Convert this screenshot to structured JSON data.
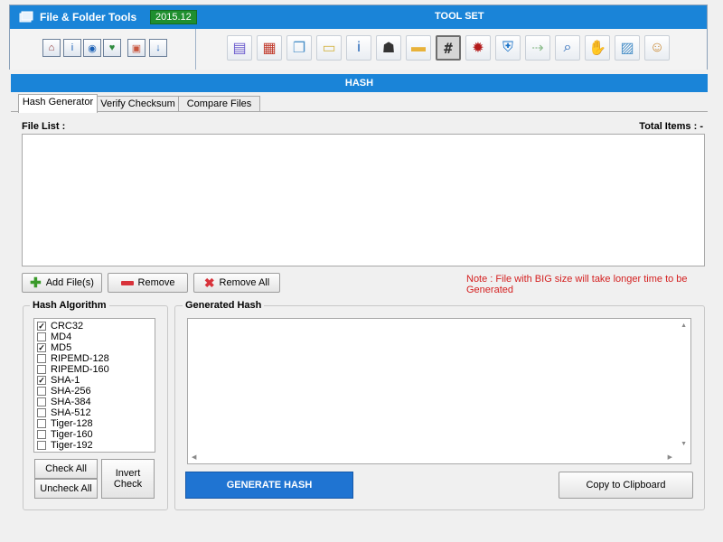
{
  "header": {
    "app_title": "File & Folder Tools",
    "version": "2015.12",
    "toolset_title": "TOOL SET",
    "quick_icons": [
      {
        "name": "home-icon",
        "glyph": "⌂",
        "color": "#8a2b2b"
      },
      {
        "name": "info-icon",
        "glyph": "i",
        "color": "#1a5fb4"
      },
      {
        "name": "broadcast-icon",
        "glyph": "◉",
        "color": "#1a5fb4"
      },
      {
        "name": "heart-plus-icon",
        "glyph": "♥",
        "color": "#2e8b3e"
      },
      {
        "name": "share-icon",
        "glyph": "▣",
        "color": "#c8553d"
      },
      {
        "name": "download-icon",
        "glyph": "↓",
        "color": "#1a5fb4"
      }
    ],
    "tool_icons": [
      {
        "name": "document-properties-icon",
        "glyph": "▤",
        "color": "#6a5acd"
      },
      {
        "name": "calendar-icon",
        "glyph": "▦",
        "color": "#c0392b"
      },
      {
        "name": "copy-files-icon",
        "glyph": "❐",
        "color": "#4a90c8"
      },
      {
        "name": "notes-icon",
        "glyph": "▭",
        "color": "#d4b64a"
      },
      {
        "name": "information-icon",
        "glyph": "i",
        "color": "#1a5fb4"
      },
      {
        "name": "detective-icon",
        "glyph": "☗",
        "color": "#333333"
      },
      {
        "name": "folder-icon",
        "glyph": "▬",
        "color": "#e8b23a"
      },
      {
        "name": "hash-icon",
        "glyph": "#",
        "color": "#333333"
      },
      {
        "name": "virus-icon",
        "glyph": "✹",
        "color": "#b31b1b"
      },
      {
        "name": "shield-icon",
        "glyph": "⛨",
        "color": "#1a73c8"
      },
      {
        "name": "exit-door-icon",
        "glyph": "⇢",
        "color": "#8fbf8f"
      },
      {
        "name": "search-icon",
        "glyph": "⌕",
        "color": "#1a5fb4"
      },
      {
        "name": "handshake-icon",
        "glyph": "✋",
        "color": "#b9864a"
      },
      {
        "name": "chart-document-icon",
        "glyph": "▨",
        "color": "#4a90c8"
      },
      {
        "name": "user-lock-icon",
        "glyph": "☺",
        "color": "#c8862e"
      }
    ]
  },
  "section_title": "HASH",
  "tabs": [
    {
      "label": "Hash Generator",
      "active": true
    },
    {
      "label": "Verify Checksum",
      "active": false
    },
    {
      "label": "Compare Files",
      "active": false
    }
  ],
  "file_list": {
    "label": "File List :",
    "total_label": "Total Items : -"
  },
  "file_buttons": {
    "add": "Add File(s)",
    "remove": "Remove",
    "remove_all": "Remove All"
  },
  "note": "Note : File with BIG size will take longer time to be Generated",
  "algorithm": {
    "title": "Hash Algorithm",
    "items": [
      {
        "label": "CRC32",
        "checked": true
      },
      {
        "label": "MD4",
        "checked": false
      },
      {
        "label": "MD5",
        "checked": true
      },
      {
        "label": "RIPEMD-128",
        "checked": false
      },
      {
        "label": "RIPEMD-160",
        "checked": false
      },
      {
        "label": "SHA-1",
        "checked": true
      },
      {
        "label": "SHA-256",
        "checked": false
      },
      {
        "label": "SHA-384",
        "checked": false
      },
      {
        "label": "SHA-512",
        "checked": false
      },
      {
        "label": "Tiger-128",
        "checked": false
      },
      {
        "label": "Tiger-160",
        "checked": false
      },
      {
        "label": "Tiger-192",
        "checked": false
      }
    ],
    "check_all": "Check All",
    "uncheck_all": "Uncheck All",
    "invert_check": "Invert Check"
  },
  "generated": {
    "title": "Generated Hash",
    "value": ""
  },
  "actions": {
    "generate": "GENERATE HASH",
    "copy": "Copy to Clipboard"
  }
}
